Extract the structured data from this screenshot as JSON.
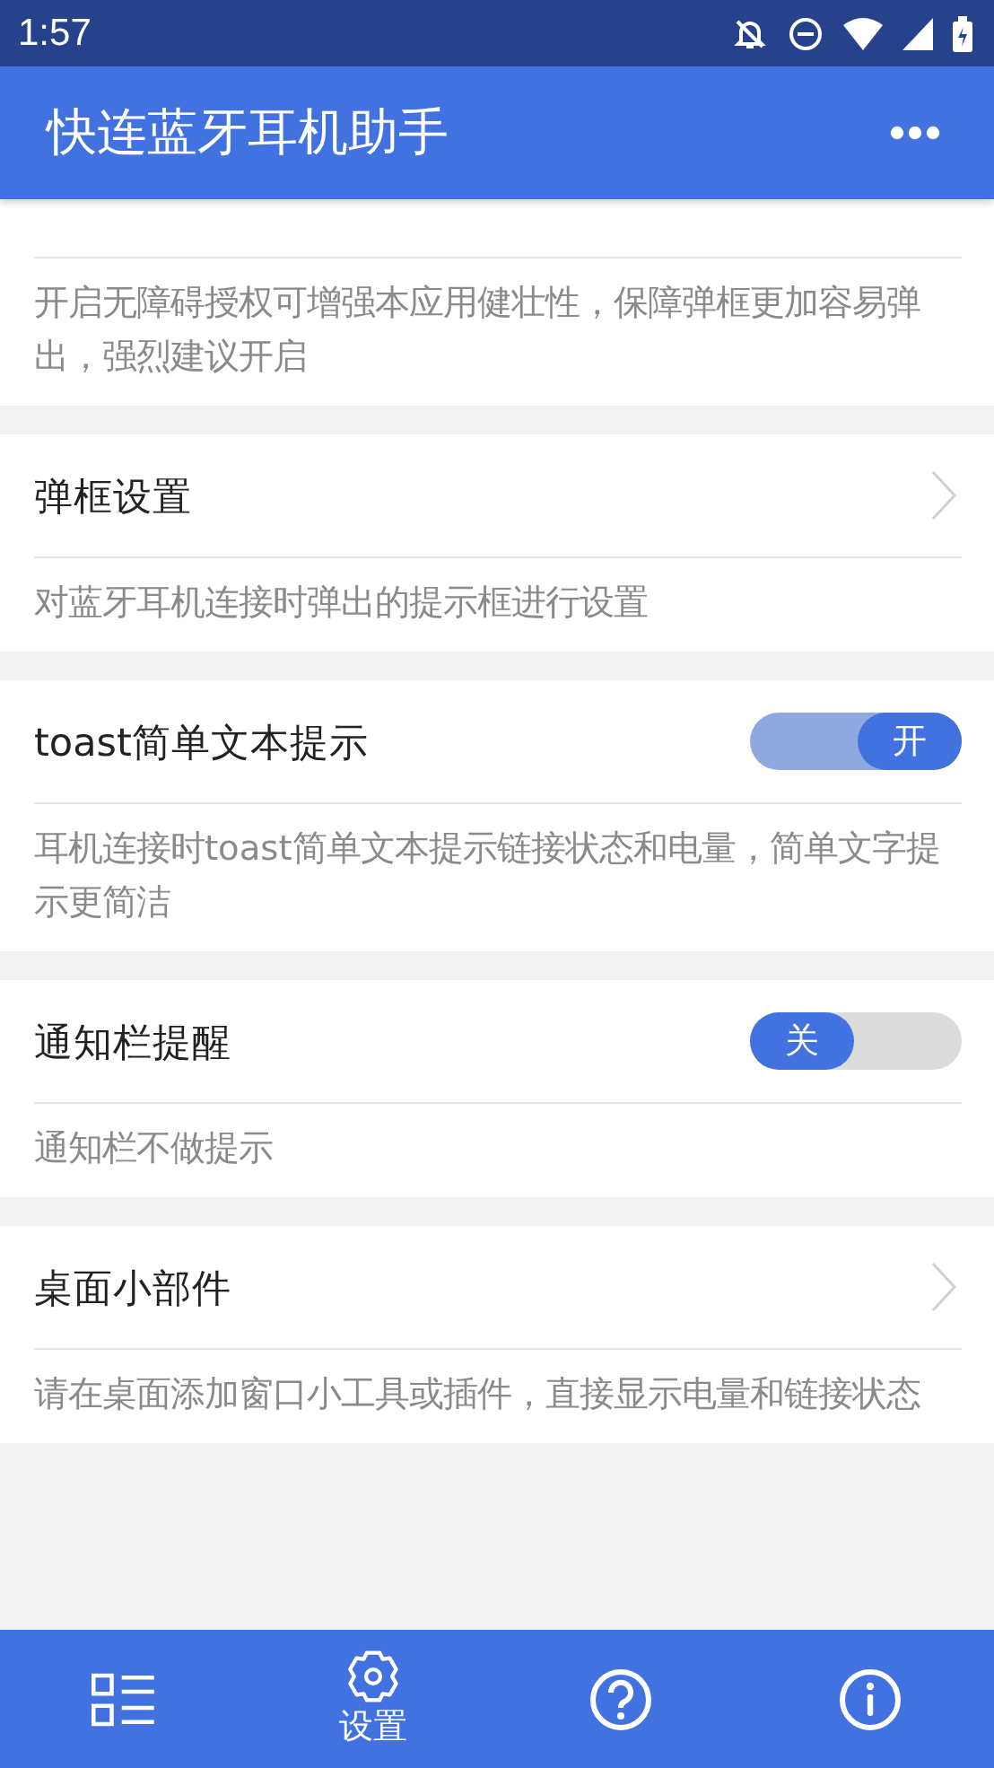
{
  "status_bar": {
    "time": "1:57"
  },
  "app_bar": {
    "title": "快连蓝牙耳机助手"
  },
  "settings": [
    {
      "kind": "hidden",
      "description": "开启无障碍授权可增强本应用健壮性，保障弹框更加容易弹出，强烈建议开启"
    },
    {
      "kind": "link",
      "title": "弹框设置",
      "description": "对蓝牙耳机连接时弹出的提示框进行设置"
    },
    {
      "kind": "switch",
      "title": "toast简单文本提示",
      "on": true,
      "switch_label": "开",
      "description": "耳机连接时toast简单文本提示链接状态和电量，简单文字提示更简洁"
    },
    {
      "kind": "switch",
      "title": "通知栏提醒",
      "on": false,
      "switch_label": "关",
      "description": "通知栏不做提示"
    },
    {
      "kind": "link",
      "title": "桌面小部件",
      "description": "请在桌面添加窗口小工具或插件，直接显示电量和链接状态"
    }
  ],
  "bottom_nav": [
    {
      "kind": "list",
      "selected": false
    },
    {
      "kind": "settings",
      "selected": true,
      "label": "设置"
    },
    {
      "kind": "help",
      "selected": false
    },
    {
      "kind": "info",
      "selected": false
    }
  ]
}
